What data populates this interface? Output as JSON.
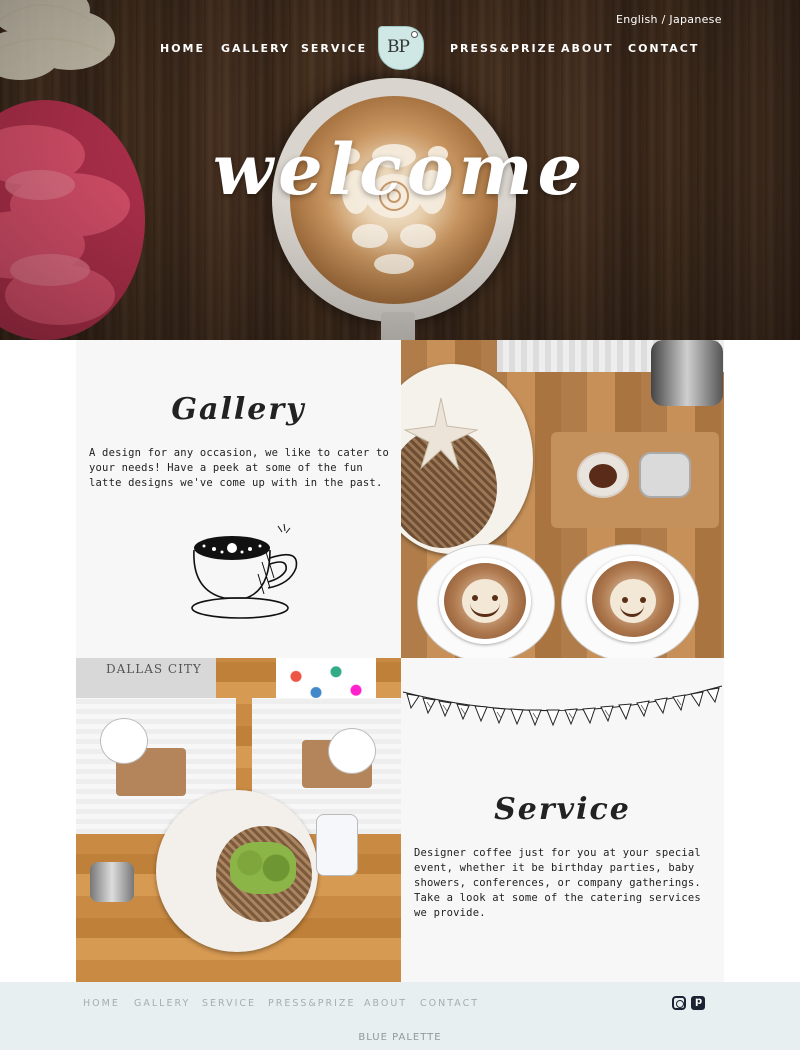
{
  "header": {
    "language_switch": "English / Japanese",
    "nav_left": [
      "HOME",
      "GALLERY",
      "SERVICE"
    ],
    "nav_right": [
      "PRESS&PRIZE",
      "ABOUT",
      "CONTACT"
    ],
    "logo_text": "BP",
    "hero_title": "welcome"
  },
  "gallery": {
    "title": "Gallery",
    "body": "A design for any occasion, we like to cater to your needs! Have a peek at some of the fun latte designs we've come up with in the past."
  },
  "service": {
    "title": "Service",
    "body": "Designer coffee just for you at your special event, whether it be birthday parties, baby showers, conferences, or company gatherings. Take a look at some of the catering services we provide."
  },
  "photo2": {
    "shirt_text": "DALLAS CITY"
  },
  "footer": {
    "nav": [
      "HOME",
      "GALLERY",
      "SERVICE",
      "PRESS&PRIZE",
      "ABOUT",
      "CONTACT"
    ],
    "brand": "BLUE PALETTE",
    "social_icons": [
      "instagram-icon",
      "pinterest-icon"
    ]
  },
  "colors": {
    "footer_bg": "#e8eff0",
    "panel_bg": "#f7f7f7",
    "logo_bg": "#cfe8e6"
  }
}
